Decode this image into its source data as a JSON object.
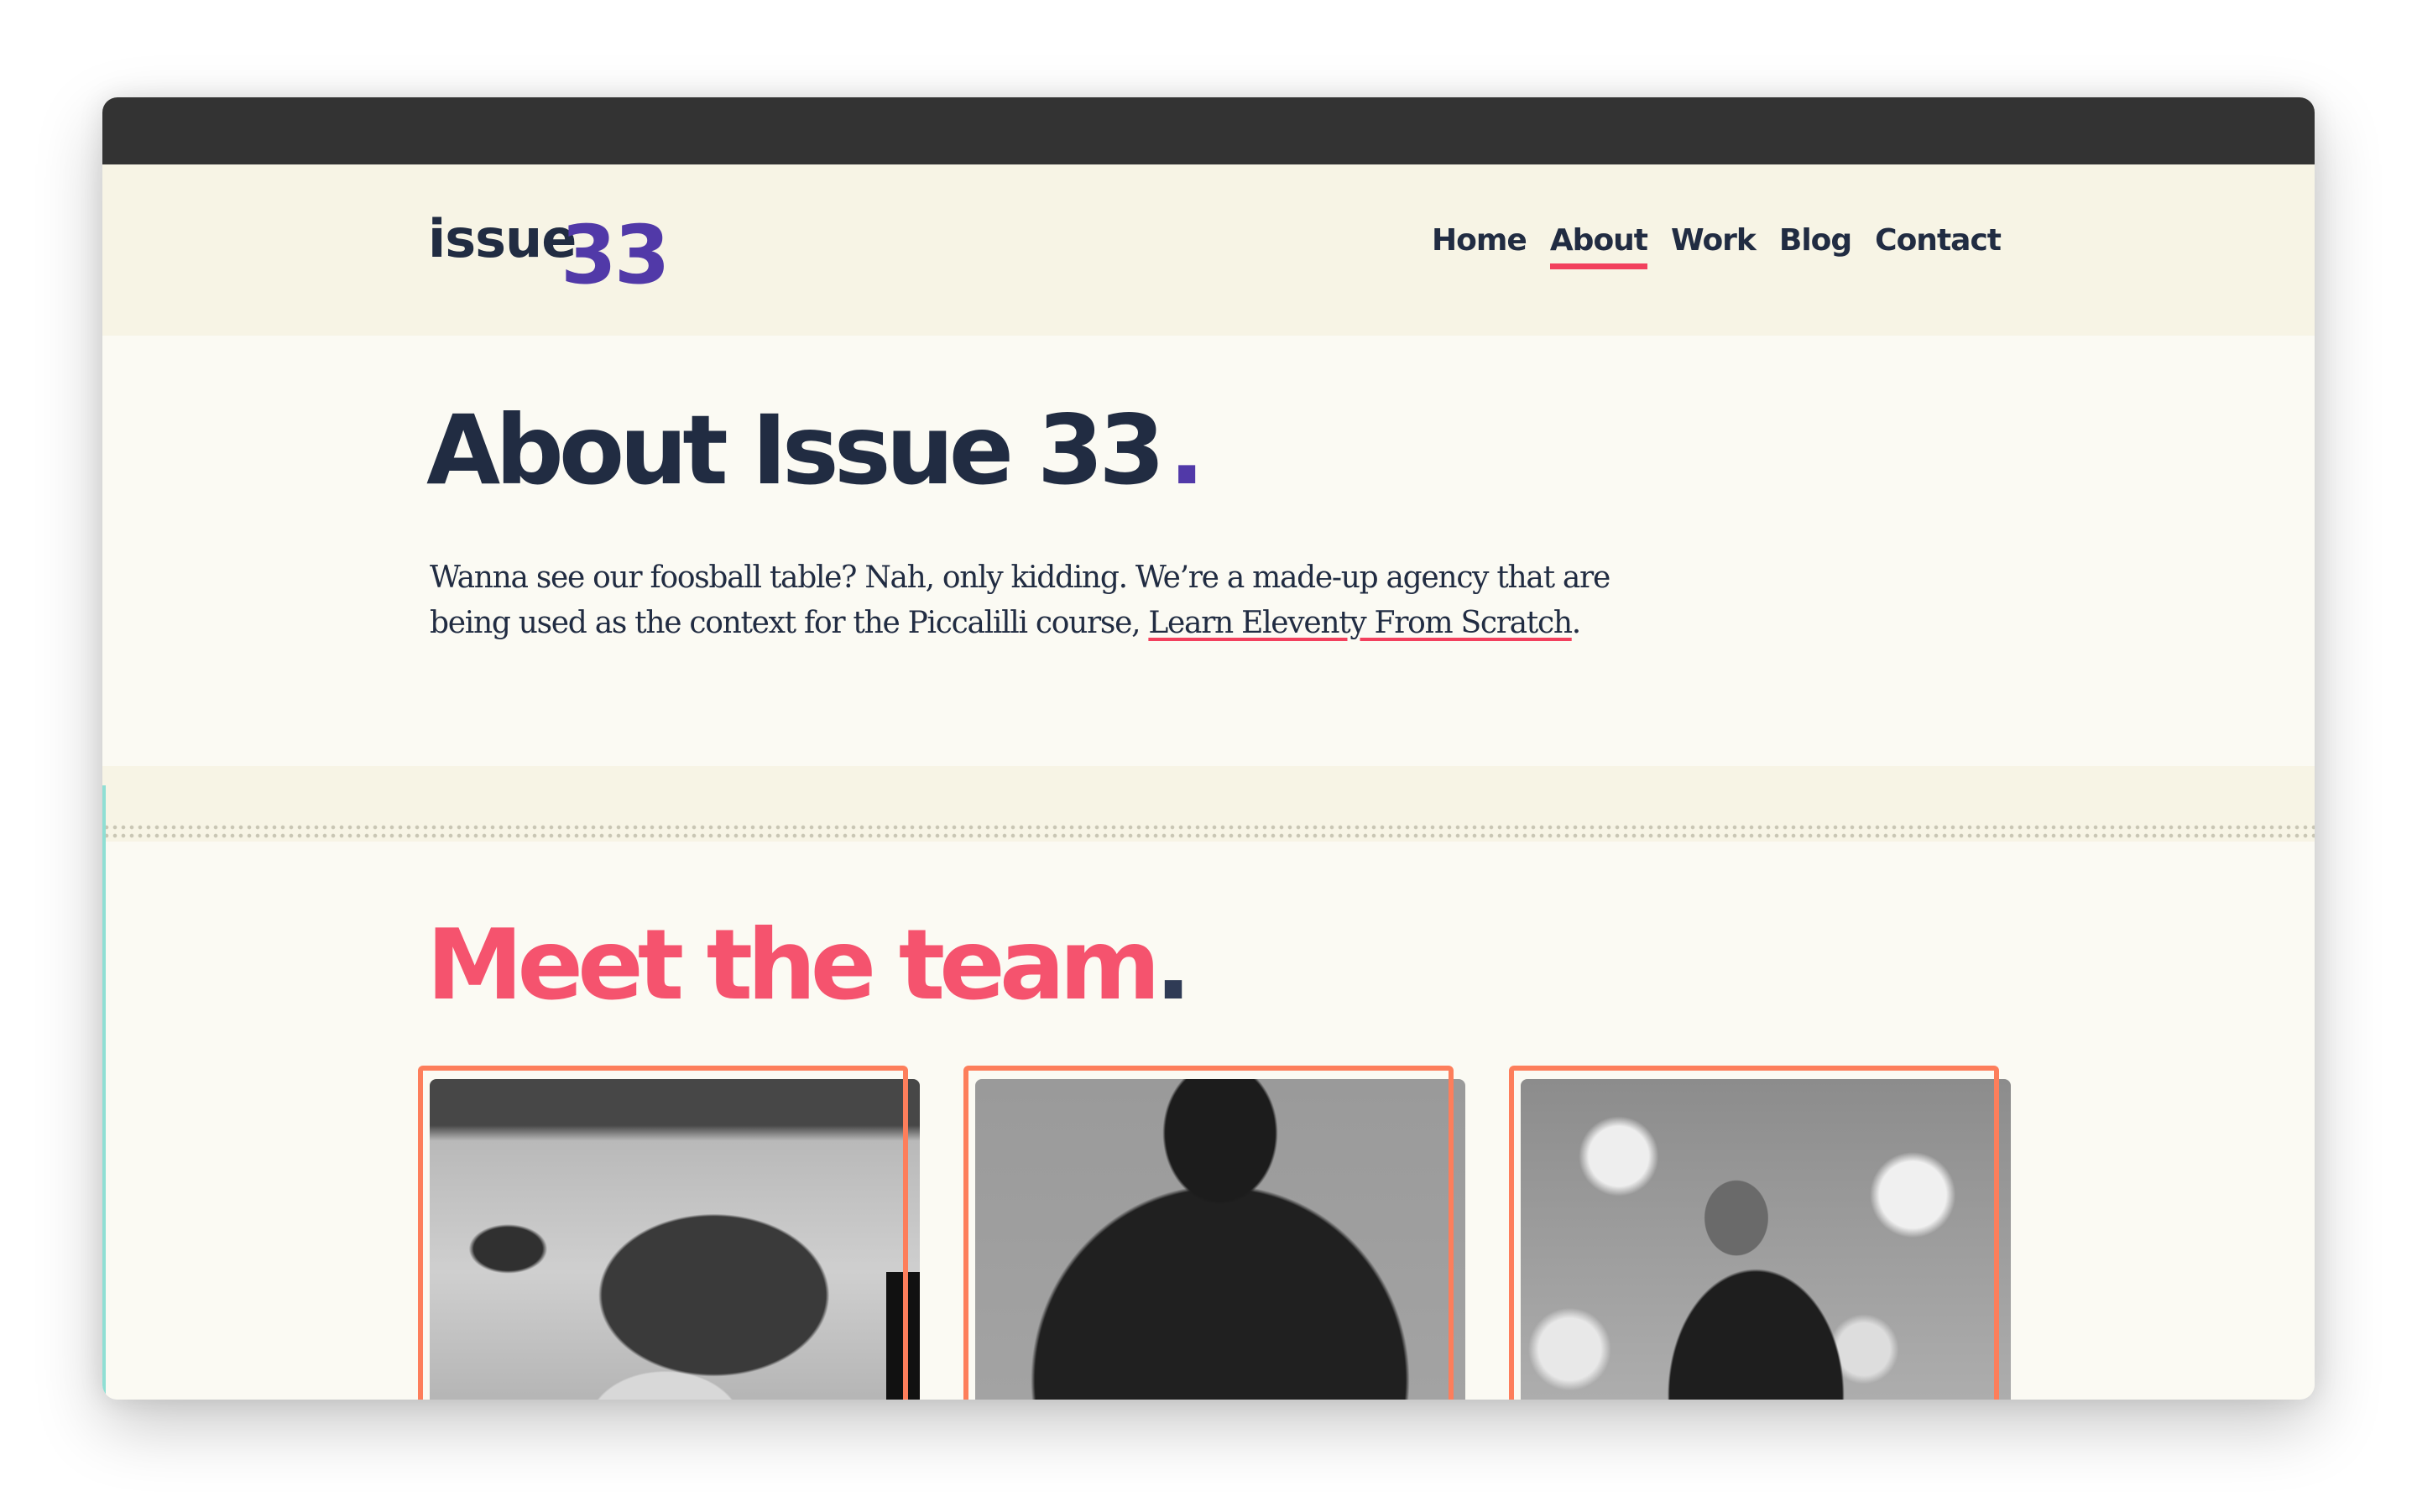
{
  "site": {
    "logo_word": "issue",
    "logo_number": "33"
  },
  "nav": {
    "items": [
      {
        "label": "Home",
        "active": false
      },
      {
        "label": "About",
        "active": true
      },
      {
        "label": "Work",
        "active": false
      },
      {
        "label": "Blog",
        "active": false
      },
      {
        "label": "Contact",
        "active": false
      }
    ]
  },
  "hero": {
    "title": "About Issue 33",
    "title_dot": ".",
    "intro_text": "Wanna see our foosball table? Nah, only kidding. We’re a made-up agency that are being used as the context for the Piccalilli course, ",
    "intro_link": "Learn Eleventy From Scratch",
    "intro_end": "."
  },
  "team": {
    "heading": "Meet the team",
    "heading_dot": ".",
    "members": [
      {
        "photo": "woman-with-messy-bun-grayscale"
      },
      {
        "photo": "woman-with-top-bun-grayscale"
      },
      {
        "photo": "man-in-black-tshirt-grayscale"
      }
    ]
  },
  "colors": {
    "accent_red": "#f2405d",
    "heading_pink": "#f5536e",
    "brand_purple": "#5139a8",
    "text_navy": "#212c42",
    "frame_orange": "#fd7e5b"
  }
}
